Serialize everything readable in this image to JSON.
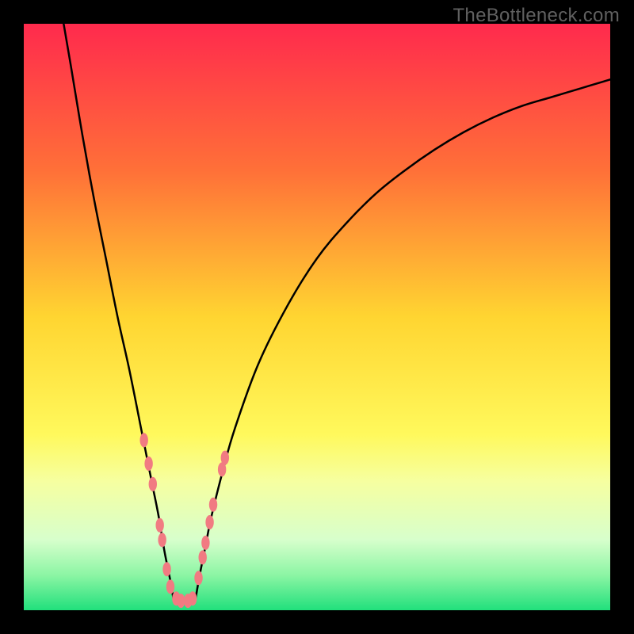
{
  "watermark": "TheBottleneck.com",
  "chart_data": {
    "type": "line",
    "title": "",
    "xlabel": "",
    "ylabel": "",
    "xlim": [
      0,
      100
    ],
    "ylim": [
      0,
      100
    ],
    "grid": false,
    "legend": false,
    "background_gradient": {
      "stops": [
        {
          "offset": 0.0,
          "color": "#ff2a4d"
        },
        {
          "offset": 0.25,
          "color": "#ff7038"
        },
        {
          "offset": 0.5,
          "color": "#ffd531"
        },
        {
          "offset": 0.7,
          "color": "#fff95c"
        },
        {
          "offset": 0.78,
          "color": "#f6ffa0"
        },
        {
          "offset": 0.88,
          "color": "#d7ffcc"
        },
        {
          "offset": 0.94,
          "color": "#8cf5a4"
        },
        {
          "offset": 1.0,
          "color": "#21e07c"
        }
      ]
    },
    "series": [
      {
        "name": "left-branch",
        "x": [
          6.8,
          8,
          10,
          12,
          14,
          16,
          18,
          20,
          21,
          22,
          23,
          24,
          25,
          25.5
        ],
        "y": [
          100,
          93,
          81,
          70,
          60,
          50,
          41,
          31,
          26,
          21,
          16,
          10,
          5,
          2
        ],
        "stroke": "#000000",
        "weight": 2.5
      },
      {
        "name": "right-branch",
        "x": [
          29.3,
          30,
          31,
          32,
          34,
          36,
          40,
          45,
          50,
          55,
          60,
          65,
          70,
          75,
          80,
          85,
          90,
          95,
          100
        ],
        "y": [
          2,
          6,
          11,
          16,
          24,
          31,
          42,
          52,
          60,
          66,
          71,
          75,
          78.5,
          81.5,
          84,
          86,
          87.5,
          89,
          90.5
        ],
        "stroke": "#000000",
        "weight": 2.5
      },
      {
        "name": "valley-floor",
        "x": [
          25.5,
          26,
          27,
          28,
          29,
          29.3
        ],
        "y": [
          2,
          1.5,
          1.3,
          1.3,
          1.5,
          2
        ],
        "stroke": "#000000",
        "weight": 2.5
      }
    ],
    "markers": {
      "name": "sample-points",
      "color": "#f17b82",
      "rx": 5.2,
      "ry": 9,
      "points": [
        {
          "x": 20.5,
          "y": 29.0
        },
        {
          "x": 21.3,
          "y": 25.0
        },
        {
          "x": 22.0,
          "y": 21.5
        },
        {
          "x": 23.2,
          "y": 14.5
        },
        {
          "x": 23.6,
          "y": 12.0
        },
        {
          "x": 24.4,
          "y": 7.0
        },
        {
          "x": 25.0,
          "y": 4.0
        },
        {
          "x": 26.0,
          "y": 2.0
        },
        {
          "x": 26.8,
          "y": 1.6
        },
        {
          "x": 28.0,
          "y": 1.6
        },
        {
          "x": 28.8,
          "y": 2.0
        },
        {
          "x": 29.8,
          "y": 5.5
        },
        {
          "x": 30.5,
          "y": 9.0
        },
        {
          "x": 31.0,
          "y": 11.5
        },
        {
          "x": 31.7,
          "y": 15.0
        },
        {
          "x": 32.3,
          "y": 18.0
        },
        {
          "x": 33.8,
          "y": 24.0
        },
        {
          "x": 34.3,
          "y": 26.0
        }
      ]
    }
  }
}
